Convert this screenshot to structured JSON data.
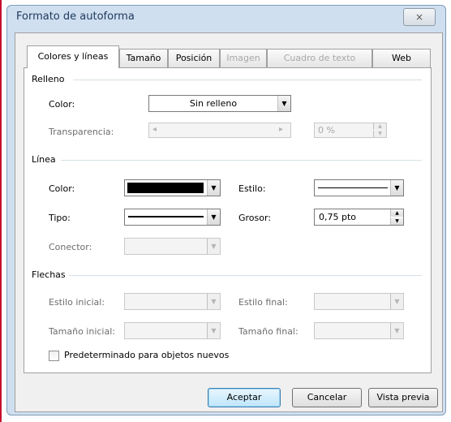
{
  "dialog": {
    "title": "Formato de autoforma",
    "close_icon": "×"
  },
  "tabs": [
    {
      "label": "Colores y líneas",
      "active": true,
      "enabled": true
    },
    {
      "label": "Tamaño",
      "active": false,
      "enabled": true
    },
    {
      "label": "Posición",
      "active": false,
      "enabled": true
    },
    {
      "label": "Imagen",
      "active": false,
      "enabled": false
    },
    {
      "label": "Cuadro de texto",
      "active": false,
      "enabled": false
    },
    {
      "label": "Web",
      "active": false,
      "enabled": true
    }
  ],
  "relleno": {
    "section_label": "Relleno",
    "color_label": "Color:",
    "color_value": "Sin relleno",
    "transparency_label": "Transparencia:",
    "transparency_value": "0 %"
  },
  "linea": {
    "section_label": "Línea",
    "color_label": "Color:",
    "color_swatch": "#000000",
    "estilo_label": "Estilo:",
    "tipo_label": "Tipo:",
    "grosor_label": "Grosor:",
    "grosor_value": "0,75 pto",
    "conector_label": "Conector:"
  },
  "flechas": {
    "section_label": "Flechas",
    "estilo_inicial_label": "Estilo inicial:",
    "estilo_final_label": "Estilo final:",
    "tamano_inicial_label": "Tamaño inicial:",
    "tamano_final_label": "Tamaño final:"
  },
  "default_checkbox": {
    "label": "Predeterminado para objetos nuevos",
    "checked": false
  },
  "buttons": {
    "accept": "Aceptar",
    "cancel": "Cancelar",
    "preview": "Vista previa"
  },
  "icons": {
    "dropdown": "▼",
    "spin_up": "▲",
    "spin_down": "▼",
    "scroll_left": "◂",
    "scroll_right": "▸"
  }
}
